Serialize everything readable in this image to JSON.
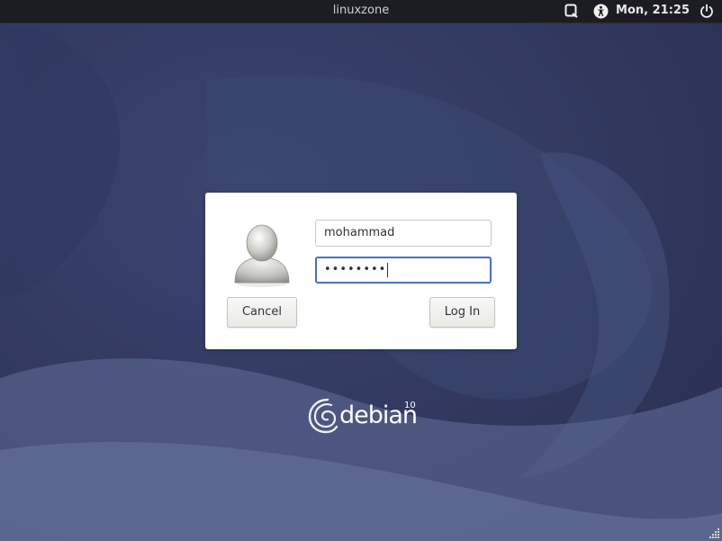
{
  "topbar": {
    "hostname": "linuxzone",
    "clock": "Mon, 21:25",
    "icons": [
      "keyboard-layout-icon",
      "accessibility-icon",
      "power-icon"
    ]
  },
  "login": {
    "username": "mohammad",
    "password_masked": "••••••••",
    "cancel_label": "Cancel",
    "login_label": "Log In"
  },
  "branding": {
    "wordmark": "debian",
    "version": "10"
  },
  "colors": {
    "topbar_bg": "#1c1d24",
    "background": "#3a4468",
    "focus_border": "#4a6fc5",
    "card_bg": "#ffffff"
  }
}
